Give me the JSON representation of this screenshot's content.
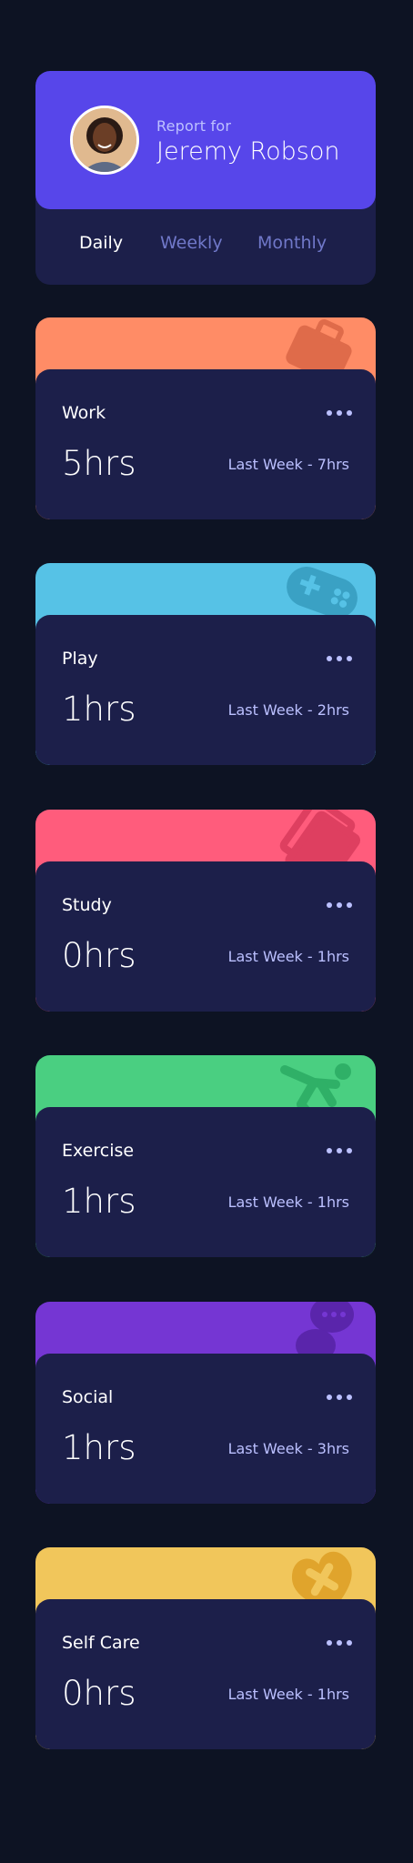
{
  "profile": {
    "report_for": "Report for",
    "name": "Jeremy Robson"
  },
  "tabs": [
    {
      "label": "Daily",
      "active": true
    },
    {
      "label": "Weekly",
      "active": false
    },
    {
      "label": "Monthly",
      "active": false
    }
  ],
  "cards": [
    {
      "title": "Work",
      "hours": "5hrs",
      "previous": "Last Week - 7hrs",
      "color": "#ff8c66",
      "icon": "briefcase-icon"
    },
    {
      "title": "Play",
      "hours": "1hrs",
      "previous": "Last Week - 2hrs",
      "color": "#56c2e6",
      "icon": "gamepad-icon"
    },
    {
      "title": "Study",
      "hours": "0hrs",
      "previous": "Last Week - 1hrs",
      "color": "#ff5c7c",
      "icon": "books-icon"
    },
    {
      "title": "Exercise",
      "hours": "1hrs",
      "previous": "Last Week - 1hrs",
      "color": "#4acf81",
      "icon": "runner-icon"
    },
    {
      "title": "Social",
      "hours": "1hrs",
      "previous": "Last Week - 3hrs",
      "color": "#7536d3",
      "icon": "chat-bubbles-icon"
    },
    {
      "title": "Self Care",
      "hours": "0hrs",
      "previous": "Last Week - 1hrs",
      "color": "#f1c65b",
      "icon": "heart-bandage-icon"
    }
  ],
  "colors": {
    "background": "#0d1323",
    "card": "#1c1f4a",
    "accent": "#5746ea",
    "muted_text": "#bbc0ff",
    "inactive_tab": "#7078c9"
  }
}
